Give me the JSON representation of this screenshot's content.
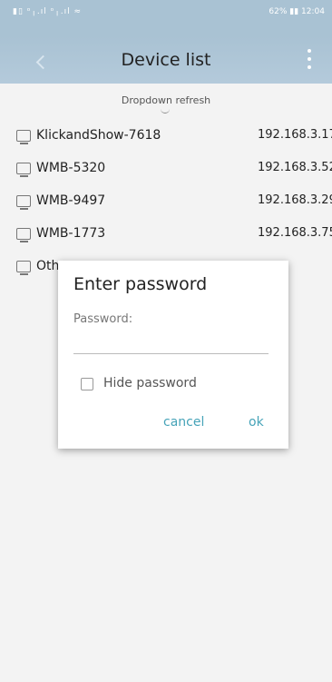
{
  "status_bar": {
    "left": "▮▯ ᵒ╷.ıl ᵒ╷.ıl ≈",
    "right": "62% ▮▮ 12:04"
  },
  "app_bar": {
    "title": "Device list",
    "back_icon": "back-chevron-icon",
    "menu_icon": "kebab-menu-icon"
  },
  "refresh_hint": "Dropdown refresh",
  "devices": [
    {
      "name": "KlickandShow-7618",
      "ip": "192.168.3.17"
    },
    {
      "name": "WMB-5320",
      "ip": "192.168.3.52"
    },
    {
      "name": "WMB-9497",
      "ip": "192.168.3.29"
    },
    {
      "name": "WMB-1773",
      "ip": "192.168.3.75"
    },
    {
      "name": "Oth",
      "ip": ""
    }
  ],
  "dialog": {
    "title": "Enter password",
    "password_label": "Password:",
    "password_value": "",
    "hide_password_label": "Hide password",
    "hide_password_checked": false,
    "cancel_label": "cancel",
    "ok_label": "ok"
  },
  "colors": {
    "app_bar": "#a9c2d3",
    "dialog_button": "#46a3b8"
  }
}
